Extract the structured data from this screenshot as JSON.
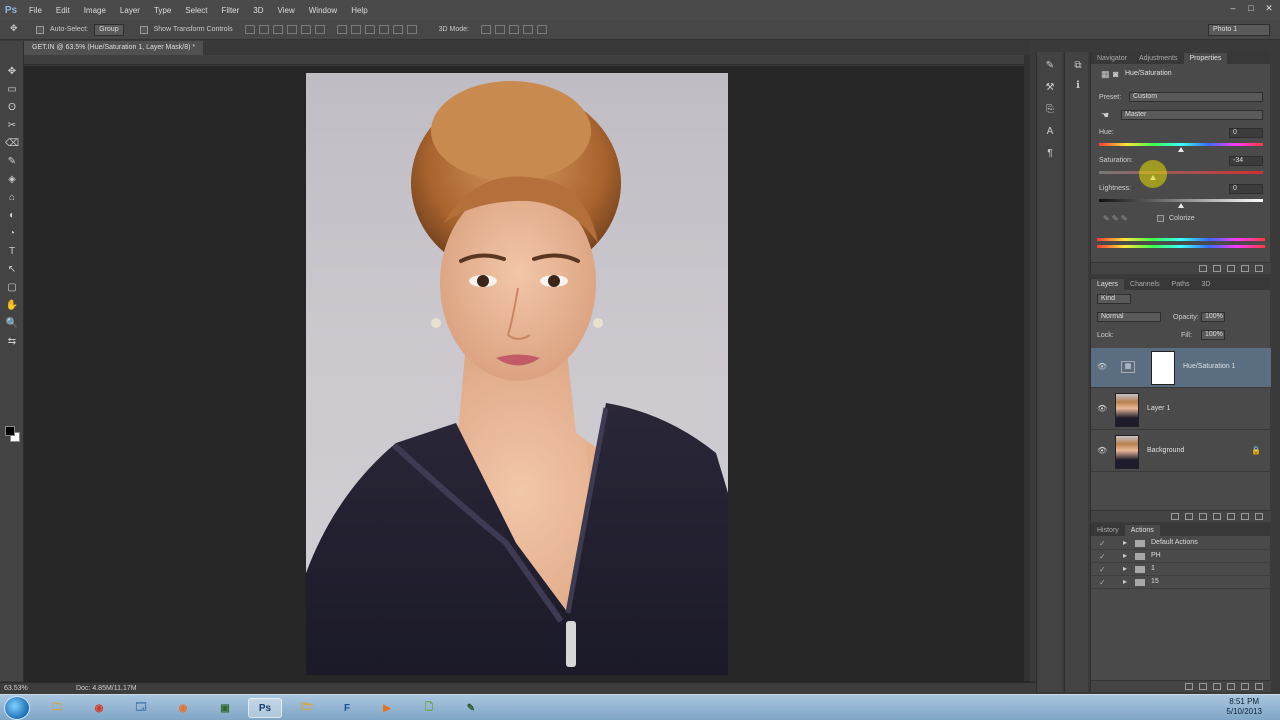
{
  "menu": {
    "logo": "Ps",
    "items": [
      "File",
      "Edit",
      "Image",
      "Layer",
      "Type",
      "Select",
      "Filter",
      "3D",
      "View",
      "Window",
      "Help"
    ],
    "window_controls": [
      "–",
      "□",
      "✕"
    ]
  },
  "options_bar": {
    "tool_glyph": "✥",
    "auto_select_label": "Auto-Select:",
    "auto_select_value": "Group",
    "transform_label": "Show Transform Controls",
    "mode_label": "3D Mode:",
    "workspace": "Photo 1"
  },
  "document": {
    "tab_label": "GET.IN @ 63.5% (Hue/Saturation 1, Layer Mask/8) *"
  },
  "toolbox": {
    "tools": [
      "✥",
      "▭",
      "ʘ",
      "✂",
      "⌫",
      "✎",
      "◈",
      "⌂",
      "◐",
      "◔",
      "T",
      "↖",
      "▢",
      "✋",
      "🔍",
      "⇆"
    ]
  },
  "properties": {
    "tabs": [
      "Navigator",
      "Adjustments",
      "Properties"
    ],
    "title": "Hue/Saturation",
    "preset_label": "Preset:",
    "preset_value": "Custom",
    "channel_value": "Master",
    "hue_label": "Hue:",
    "hue_value": "0",
    "saturation_label": "Saturation:",
    "saturation_value": "-34",
    "lightness_label": "Lightness:",
    "lightness_value": "0",
    "colorize_label": "Colorize"
  },
  "layers_panel": {
    "tabs": [
      "Layers",
      "Channels",
      "Paths",
      "3D"
    ],
    "kind": "Kind",
    "blend_mode": "Normal",
    "opacity_label": "Opacity:",
    "opacity_value": "100%",
    "lock_label": "Lock:",
    "fill_label": "Fill:",
    "fill_value": "100%",
    "layers": [
      {
        "name": "Hue/Saturation 1"
      },
      {
        "name": "Layer 1"
      },
      {
        "name": "Background"
      }
    ]
  },
  "actions_panel": {
    "tabs": [
      "History",
      "Actions"
    ],
    "items": [
      {
        "name": "Default Actions"
      },
      {
        "name": "PH"
      },
      {
        "name": "1"
      },
      {
        "name": "15"
      }
    ]
  },
  "status": {
    "zoom": "63.53%",
    "doc": "Doc: 4.85M/11.17M"
  },
  "taskbar": {
    "apps": [
      "🗀",
      "◉",
      "🗔",
      "◉",
      "▣",
      "Ps",
      "🗁",
      "F",
      "▶",
      "🗋",
      "✎"
    ],
    "time": "8:51 PM",
    "date": "5/10/2013"
  }
}
